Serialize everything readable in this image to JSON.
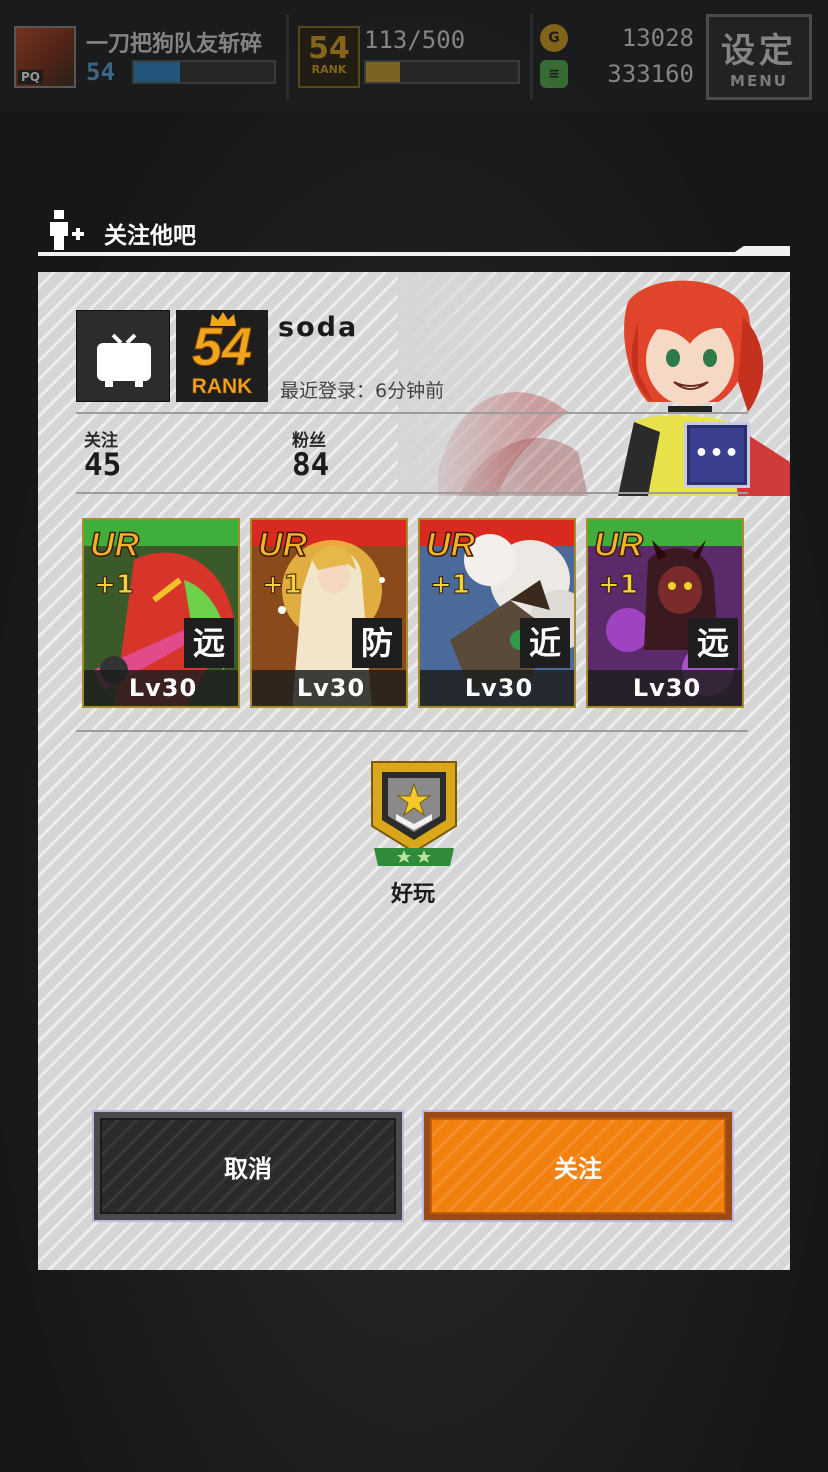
{
  "hud": {
    "player_name": "一刀把狗队友斩碎",
    "player_level": "54",
    "rank_number": "54",
    "rank_label": "RANK",
    "stamina": "113/500",
    "gold": "13028",
    "gems": "333160",
    "menu_big": "设定",
    "menu_small": "MENU",
    "avatar_tag": "PQ"
  },
  "dialog": {
    "title": "关注他吧",
    "rank_number": "54",
    "rank_label": "RANK",
    "player_name": "soda",
    "last_login": "最近登录：6分钟前",
    "follow_label": "关注",
    "follow_count": "45",
    "fans_label": "粉丝",
    "fans_count": "84",
    "more_label": "•••",
    "cards": [
      {
        "rarity": "UR",
        "plus": "+1",
        "type": "远",
        "level": "Lv30"
      },
      {
        "rarity": "UR",
        "plus": "+1",
        "type": "防",
        "level": "Lv30"
      },
      {
        "rarity": "UR",
        "plus": "+1",
        "type": "近",
        "level": "Lv30"
      },
      {
        "rarity": "UR",
        "plus": "+1",
        "type": "远",
        "level": "Lv30"
      }
    ],
    "emblem_label": "好玩",
    "cancel_label": "取消",
    "confirm_label": "关注"
  },
  "colors": {
    "accent_orange": "#f2800f",
    "rank_gold": "#f0a51d",
    "more_button_blue": "#3a3f8f"
  },
  "progress": {
    "player_xp_fraction": 0.33,
    "stamina_fraction": 0.226
  }
}
